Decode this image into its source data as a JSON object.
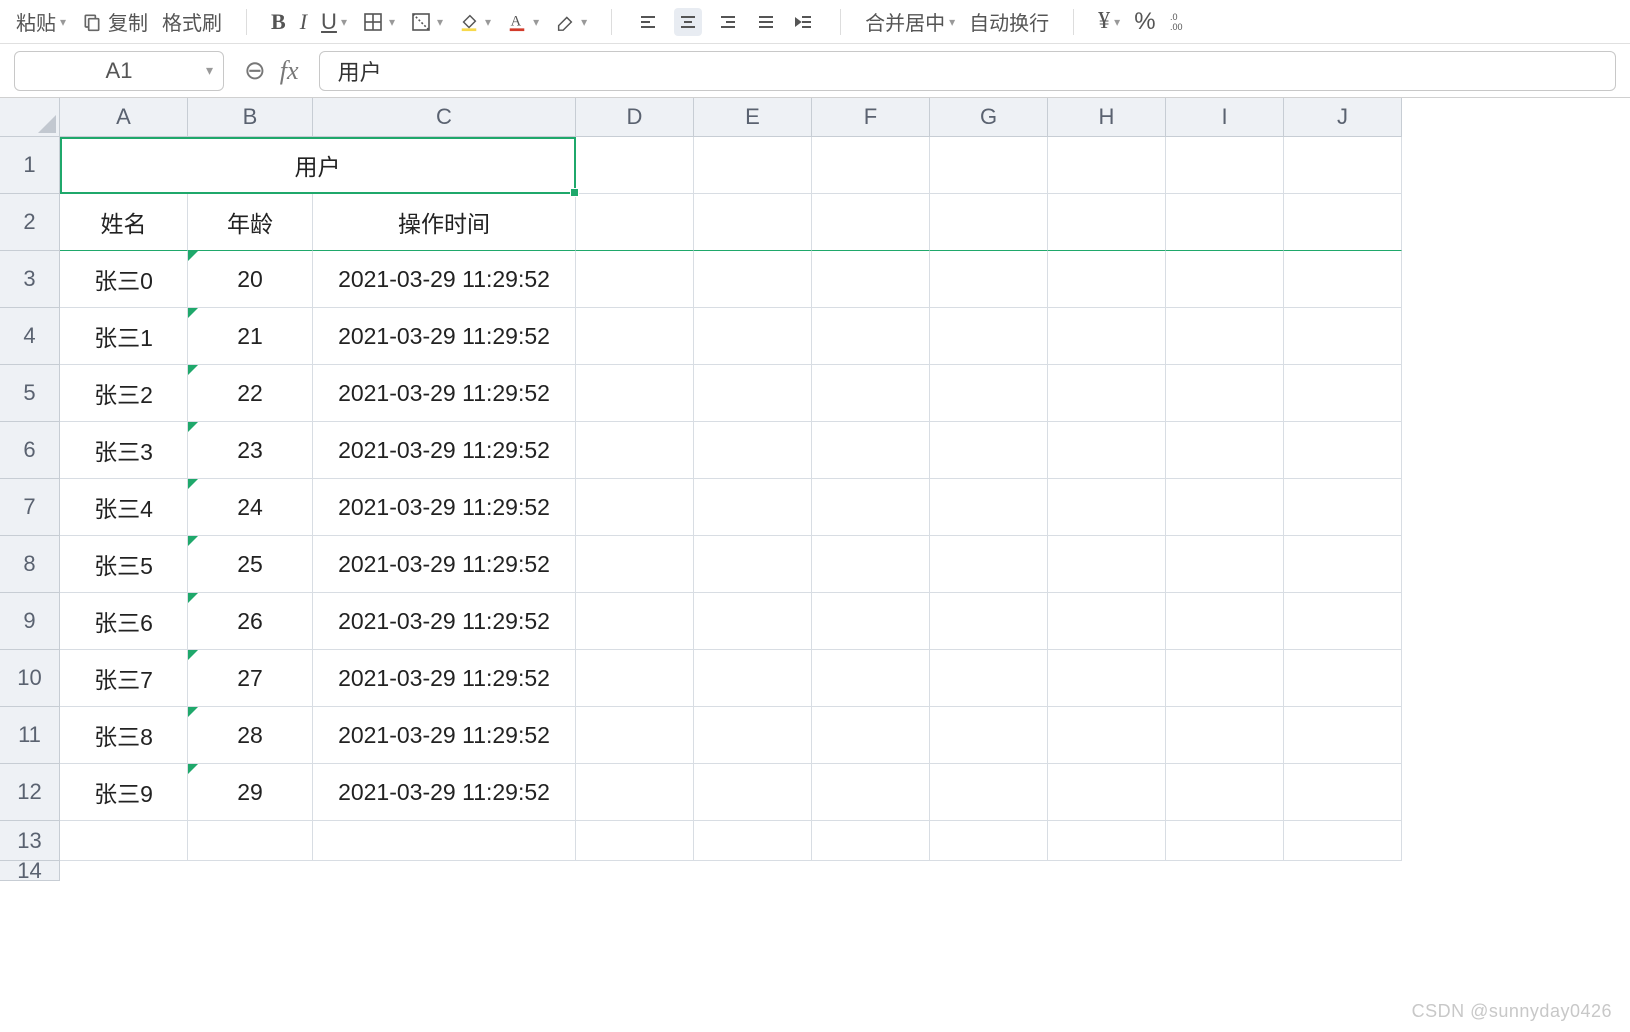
{
  "toolbar": {
    "paste": "粘贴",
    "copy": "复制",
    "format_painter": "格式刷",
    "merge_center": "合并居中",
    "wrap_text": "自动换行",
    "currency": "¥",
    "percent": "%",
    "decimal": ".00"
  },
  "namebox": "A1",
  "formula_value": "用户",
  "columns": [
    "A",
    "B",
    "C",
    "D",
    "E",
    "F",
    "G",
    "H",
    "I",
    "J"
  ],
  "row_numbers": [
    1,
    2,
    3,
    4,
    5,
    6,
    7,
    8,
    9,
    10,
    11,
    12,
    13,
    14
  ],
  "merged_title": "用户",
  "headers": {
    "name": "姓名",
    "age": "年龄",
    "time": "操作时间"
  },
  "data": [
    {
      "name": "张三0",
      "age": "20",
      "time": "2021-03-29 11:29:52"
    },
    {
      "name": "张三1",
      "age": "21",
      "time": "2021-03-29 11:29:52"
    },
    {
      "name": "张三2",
      "age": "22",
      "time": "2021-03-29 11:29:52"
    },
    {
      "name": "张三3",
      "age": "23",
      "time": "2021-03-29 11:29:52"
    },
    {
      "name": "张三4",
      "age": "24",
      "time": "2021-03-29 11:29:52"
    },
    {
      "name": "张三5",
      "age": "25",
      "time": "2021-03-29 11:29:52"
    },
    {
      "name": "张三6",
      "age": "26",
      "time": "2021-03-29 11:29:52"
    },
    {
      "name": "张三7",
      "age": "27",
      "time": "2021-03-29 11:29:52"
    },
    {
      "name": "张三8",
      "age": "28",
      "time": "2021-03-29 11:29:52"
    },
    {
      "name": "张三9",
      "age": "29",
      "time": "2021-03-29 11:29:52"
    }
  ],
  "watermark": "CSDN @sunnyday0426"
}
